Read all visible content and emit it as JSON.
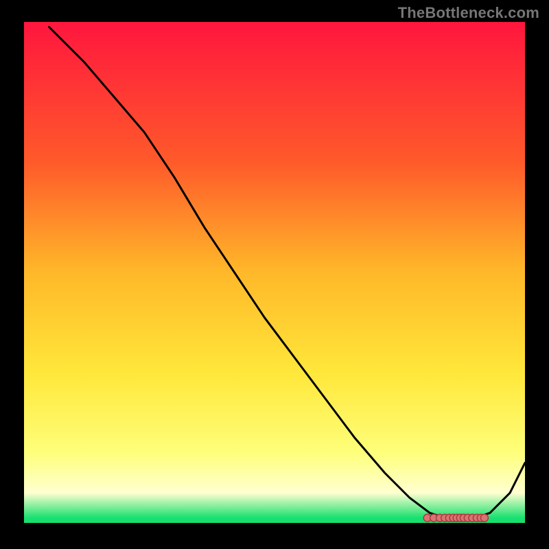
{
  "watermark": "TheBottleneck.com",
  "colors": {
    "bg": "#000000",
    "grad_top": "#ff163e",
    "grad_mid1": "#ff5a2a",
    "grad_mid2": "#ffb829",
    "grad_mid3": "#ffe73a",
    "grad_low1": "#feff7a",
    "grad_low2": "#ffffd0",
    "grad_green": "#18e06f",
    "line": "#000000",
    "dots_stroke": "#b03a3a",
    "dots_fill": "#d97474"
  },
  "chart_data": {
    "type": "line",
    "title": "",
    "xlabel": "",
    "ylabel": "",
    "xlim": [
      0,
      100
    ],
    "ylim": [
      0,
      100
    ],
    "series": [
      {
        "name": "curve",
        "x": [
          5,
          12,
          18,
          24,
          30,
          36,
          42,
          48,
          54,
          60,
          66,
          72,
          77,
          81,
          84,
          87,
          90,
          93,
          97,
          100
        ],
        "y": [
          99,
          92,
          85,
          78,
          69,
          59,
          50,
          41,
          33,
          25,
          17,
          10,
          5,
          2,
          1,
          1,
          1,
          2,
          6,
          12
        ]
      }
    ],
    "markers": {
      "name": "baseline-dots",
      "x": [
        80.5,
        81.8,
        83.0,
        84.0,
        84.9,
        85.7,
        86.4,
        87.1,
        87.8,
        88.6,
        89.5,
        90.4,
        91.2,
        91.9
      ],
      "y": [
        1,
        1,
        1,
        1,
        1,
        1,
        1,
        1,
        1,
        1,
        1,
        1,
        1,
        1
      ]
    }
  }
}
